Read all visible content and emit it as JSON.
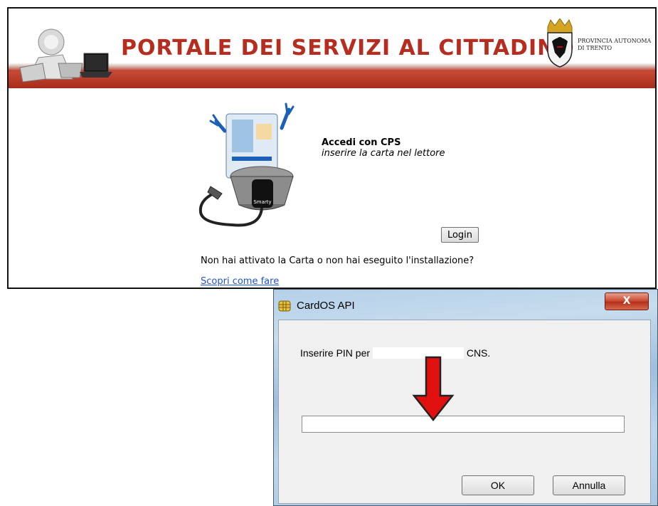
{
  "portal": {
    "title": "PORTALE DEI SERVIZI AL CITTADINO",
    "province_line1": "PROVINCIA AUTONOMA",
    "province_line2": "DI TRENTO",
    "card_reader_label": "Smarty",
    "cps_title": "Accedi con CPS",
    "cps_subtitle": "inserire la carta nel lettore",
    "login_label": "Login",
    "activation_question": "Non hai attivato la Carta o non hai eseguito l'installazione?",
    "discover_link": "Scopri come fare"
  },
  "dialog": {
    "title": "CardOS API",
    "close_label": "X",
    "pin_prompt_prefix": "Inserire PIN per",
    "pin_prompt_suffix": "CNS.",
    "pin_value": "",
    "ok_label": "OK",
    "cancel_label": "Annulla"
  },
  "icons": {
    "app_logo": "computer-user-logo-icon",
    "crest": "trento-eagle-crest-icon",
    "card_reader": "smart-card-reader-icon",
    "dialog_icon": "smart-card-chip-icon",
    "arrow": "red-down-arrow-icon"
  },
  "colors": {
    "portal_red": "#b62d1f",
    "link_blue": "#2255cc",
    "arrow_red": "#e01010",
    "dialog_frame": "#b5d0ea"
  }
}
